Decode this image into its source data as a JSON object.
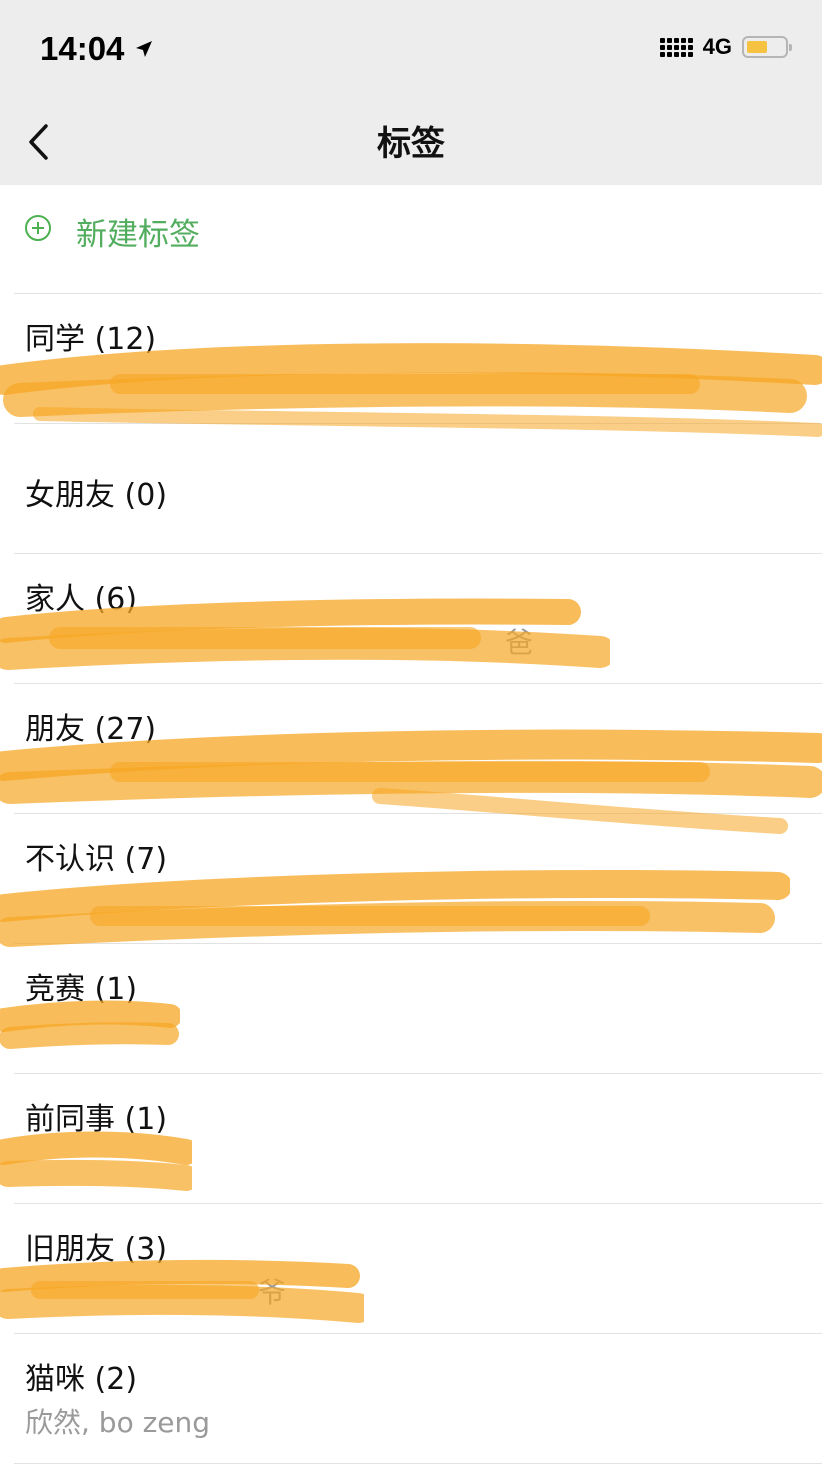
{
  "status_bar": {
    "time": "14:04",
    "network": "4G",
    "battery_color": "#f5c242"
  },
  "nav": {
    "title": "标签"
  },
  "new_tag": {
    "label": "新建标签",
    "accent": "#52ad5e"
  },
  "tags": [
    {
      "name": "同学 (12)",
      "members": "",
      "redacted": true
    },
    {
      "name": "女朋友 (0)",
      "members": "",
      "redacted": false
    },
    {
      "name": "家人 (6)",
      "members": "爸",
      "redacted": true
    },
    {
      "name": "朋友 (27)",
      "members": "",
      "redacted": true
    },
    {
      "name": "不认识 (7)",
      "members": "",
      "redacted": true
    },
    {
      "name": "竞赛 (1)",
      "members": "",
      "redacted": true
    },
    {
      "name": "前同事 (1)",
      "members": "",
      "redacted": true
    },
    {
      "name": "旧朋友 (3)",
      "members": "爷",
      "redacted": true
    },
    {
      "name": "猫咪 (2)",
      "members": "欣然, bo zeng",
      "redacted": false
    }
  ],
  "redaction_color": "#f6a623"
}
